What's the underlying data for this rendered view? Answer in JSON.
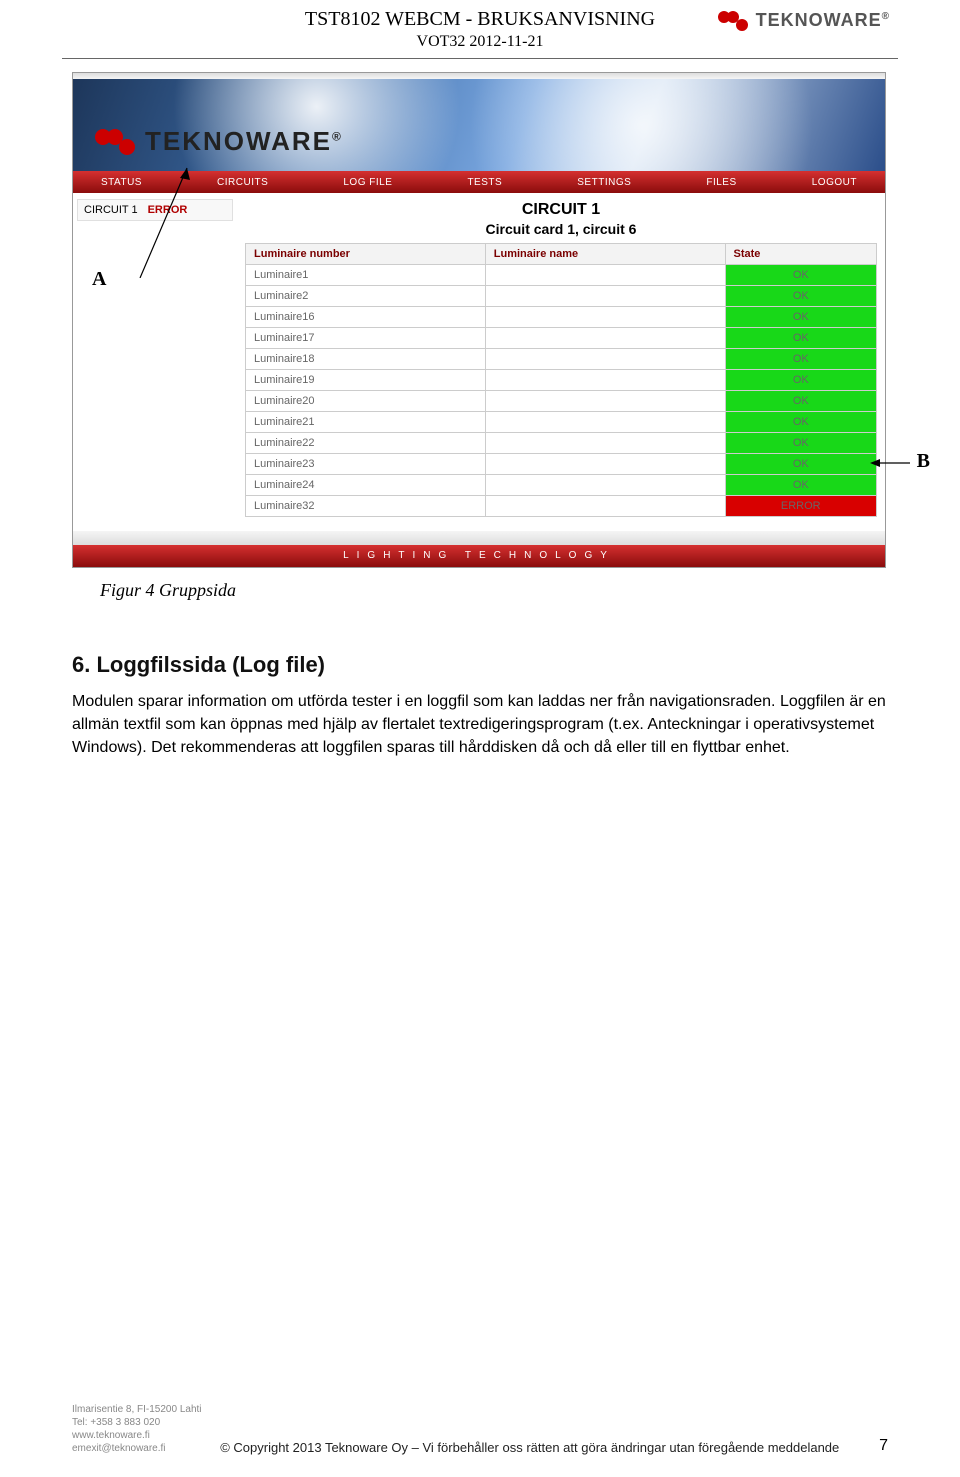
{
  "header": {
    "line1": "TST8102 WEBCM - BRUKSANVISNING",
    "line2": "VOT32 2012-11-21"
  },
  "brand": {
    "name": "TEKNOWARE",
    "reg": "®"
  },
  "app": {
    "nav": [
      "STATUS",
      "CIRCUITS",
      "LOG FILE",
      "TESTS",
      "SETTINGS",
      "FILES",
      "LOGOUT"
    ],
    "sidebar": {
      "label": "CIRCUIT 1",
      "state": "ERROR"
    },
    "title1": "CIRCUIT 1",
    "title2": "Circuit card 1, circuit 6",
    "columns": {
      "c1": "Luminaire number",
      "c2": "Luminaire name",
      "c3": "State"
    },
    "rows": [
      {
        "num": "Luminaire1",
        "name": "",
        "state": "OK"
      },
      {
        "num": "Luminaire2",
        "name": "",
        "state": "OK"
      },
      {
        "num": "Luminaire16",
        "name": "",
        "state": "OK"
      },
      {
        "num": "Luminaire17",
        "name": "",
        "state": "OK"
      },
      {
        "num": "Luminaire18",
        "name": "",
        "state": "OK"
      },
      {
        "num": "Luminaire19",
        "name": "",
        "state": "OK"
      },
      {
        "num": "Luminaire20",
        "name": "",
        "state": "OK"
      },
      {
        "num": "Luminaire21",
        "name": "",
        "state": "OK"
      },
      {
        "num": "Luminaire22",
        "name": "",
        "state": "OK"
      },
      {
        "num": "Luminaire23",
        "name": "",
        "state": "OK"
      },
      {
        "num": "Luminaire24",
        "name": "",
        "state": "OK"
      },
      {
        "num": "Luminaire32",
        "name": "",
        "state": "ERROR"
      }
    ],
    "footer_text": "LIGHTING TECHNOLOGY"
  },
  "labels": {
    "a": "A",
    "b": "B"
  },
  "caption": "Figur 4 Gruppsida",
  "section": {
    "heading": "6. Loggfilssida (Log file)",
    "body": "Modulen sparar information om utförda tester i en loggfil som kan laddas ner från navigationsraden. Loggfilen är en allmän textfil som kan öppnas med hjälp av flertalet textredigeringsprogram (t.ex. Anteckningar i operativsystemet Windows). Det rekommenderas att loggfilen sparas till hårddisken då och då eller till en flyttbar enhet."
  },
  "footer": {
    "addr1": "Ilmarisentie 8, FI-15200 Lahti",
    "addr2": "Tel: +358 3 883 020",
    "addr3": "www.teknoware.fi",
    "addr4": "emexit@teknoware.fi",
    "copyright": "© Copyright 2013 Teknoware Oy – Vi förbehåller oss rätten att göra ändringar utan föregående meddelande",
    "page": "7"
  }
}
